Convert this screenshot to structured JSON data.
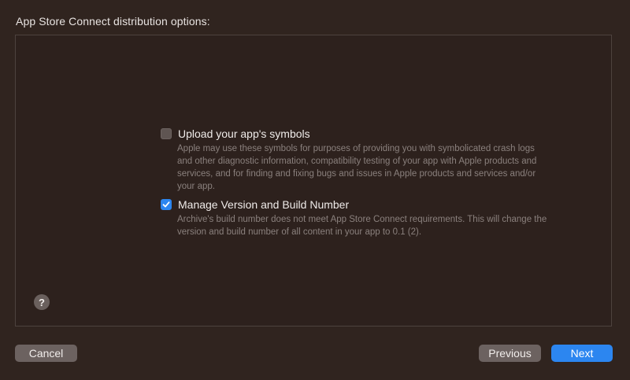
{
  "heading": "App Store Connect distribution options:",
  "options": [
    {
      "title": "Upload your app's symbols",
      "checked": false,
      "description": "Apple may use these symbols for purposes of providing you with symbolicated crash logs and other diagnostic information, compatibility testing of your app with Apple products and services, and for finding and fixing bugs and issues in Apple products and services and/or your app."
    },
    {
      "title": "Manage Version and Build Number",
      "checked": true,
      "description": "Archive's build number does not meet App Store Connect requirements. This will change the version and build number of all content in your app to 0.1 (2)."
    }
  ],
  "help": {
    "glyph": "?",
    "icon": "help-icon"
  },
  "buttons": {
    "cancel": "Cancel",
    "previous": "Previous",
    "next": "Next"
  },
  "colors": {
    "background": "#30241f",
    "accent": "#2c86f0",
    "secondary_button": "#6c6260"
  }
}
